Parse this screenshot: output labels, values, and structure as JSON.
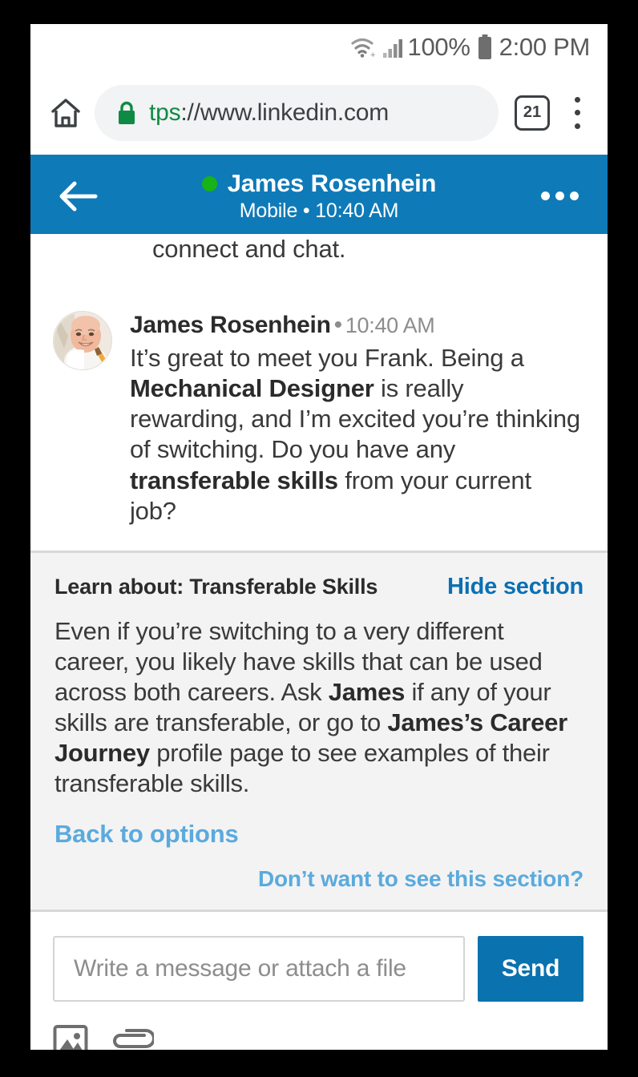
{
  "status_bar": {
    "wifi_icon": "wifi-icon",
    "signal_icon": "cellular-signal-icon",
    "battery_percent": "100%",
    "battery_icon": "battery-full-icon",
    "clock": "2:00 PM"
  },
  "browser": {
    "home_icon": "home-icon",
    "lock_icon": "lock-secure-icon",
    "url_scheme": "tps",
    "url_rest": "://www.linkedin.com",
    "tab_count": "21",
    "menu_icon": "kebab-menu-icon"
  },
  "conversation_header": {
    "back_icon": "back-arrow-icon",
    "online_status": "online",
    "name": "James Rosenhein",
    "subtitle": "Mobile  •  10:40 AM",
    "more_icon": "more-options-icon",
    "background_color": "#0f7ab8"
  },
  "thread": {
    "previous_message_tail": "connect and chat.",
    "message": {
      "avatar_name": "james-rosenhein-avatar",
      "author": "James Rosenhein",
      "separator": "•",
      "time": "10:40 AM",
      "text_parts": [
        {
          "text": "It’s great to meet you Frank. Being a ",
          "bold": false
        },
        {
          "text": "Mechanical Designer",
          "bold": true
        },
        {
          "text": " is really rewarding, and I’m excited you’re thinking of switching. Do you have any ",
          "bold": false
        },
        {
          "text": "transferable skills",
          "bold": true
        },
        {
          "text": " from your current job?",
          "bold": false
        }
      ]
    }
  },
  "learn_section": {
    "title": "Learn about: Transferable Skills",
    "hide_label": "Hide section",
    "body_parts": [
      {
        "text": "Even if you’re switching to a very different career, you likely have skills that can be used across both careers. Ask ",
        "bold": false
      },
      {
        "text": "James",
        "bold": true
      },
      {
        "text": " if any of your skills are transferable, or go to ",
        "bold": false
      },
      {
        "text": "James’s Career Journey",
        "bold": true
      },
      {
        "text": " profile page to see examples of their transferable skills.",
        "bold": false
      }
    ],
    "back_to_options": "Back to options",
    "dont_want": "Don’t want to see this section?",
    "background_color": "#f3f3f3",
    "link_color": "#5aaade",
    "hide_link_color": "#0a70b5"
  },
  "composer": {
    "placeholder": "Write a message or attach a file",
    "input_value": "",
    "send_label": "Send",
    "send_color": "#0a72ae",
    "image_icon": "image-attachment-icon",
    "file_icon": "paperclip-attachment-icon"
  }
}
